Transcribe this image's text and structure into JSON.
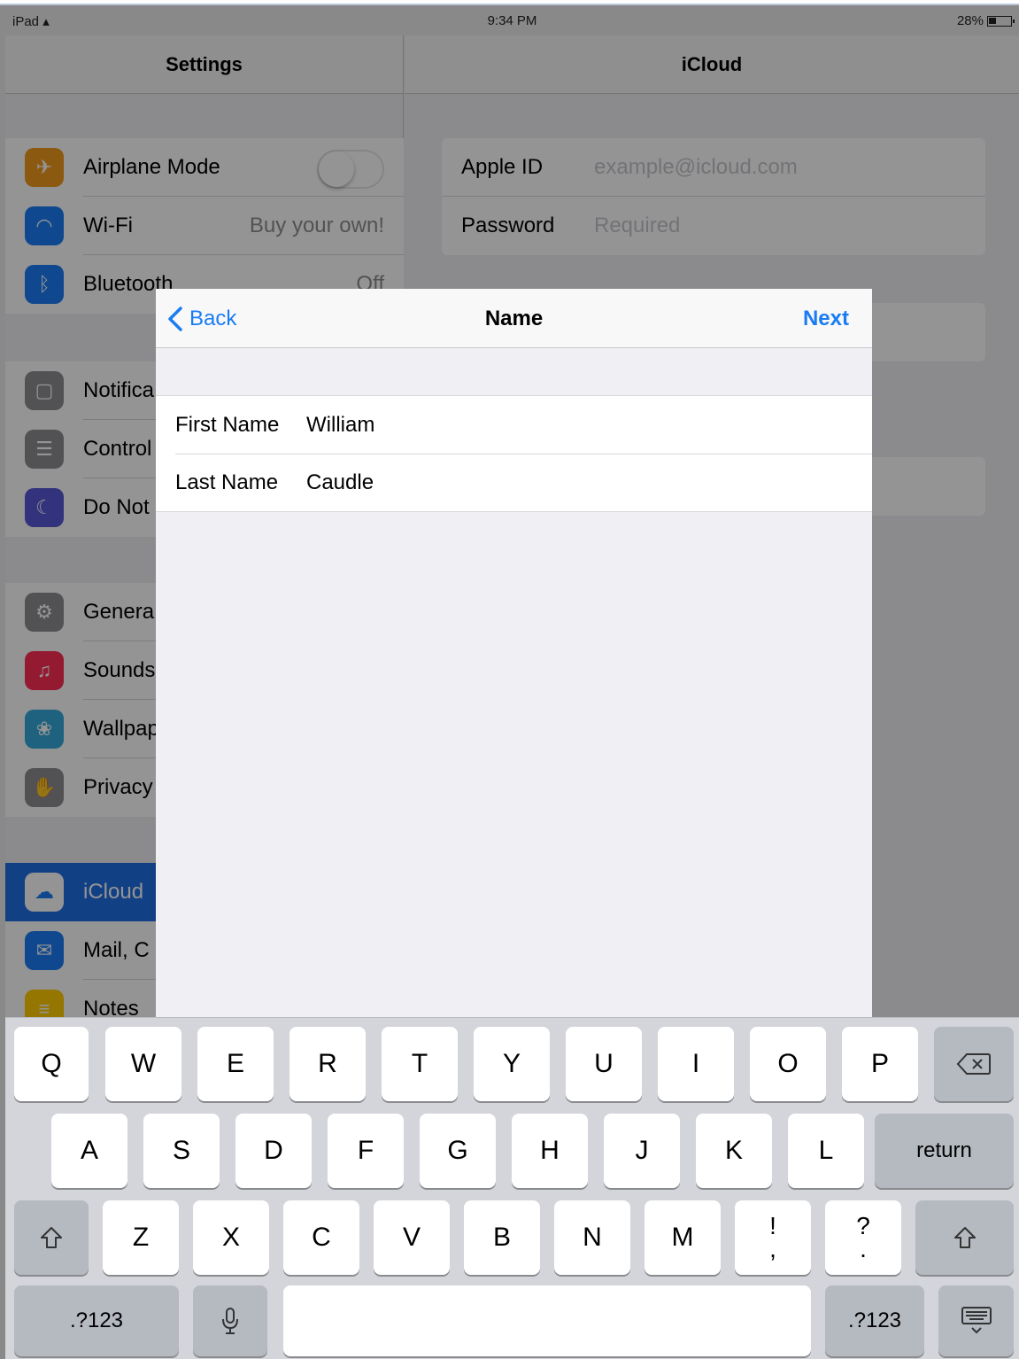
{
  "status_bar": {
    "device": "iPad",
    "time": "9:34 PM",
    "battery": "28%"
  },
  "master": {
    "title": "Settings",
    "group1": [
      {
        "label": "Airplane Mode",
        "icon": "airplane-icon",
        "color": "#f29a1d",
        "value": ""
      },
      {
        "label": "Wi-Fi",
        "icon": "wifi-icon",
        "color": "#1a7cf5",
        "value": "Buy your own!"
      },
      {
        "label": "Bluetooth",
        "icon": "bluetooth-icon",
        "color": "#1a7cf5",
        "value": "Off"
      }
    ],
    "group2": [
      {
        "label": "Notifica",
        "icon": "notifications-icon",
        "color": "#8e8e93"
      },
      {
        "label": "Control",
        "icon": "control-center-icon",
        "color": "#8e8e93"
      },
      {
        "label": "Do Not",
        "icon": "moon-icon",
        "color": "#5856d6"
      }
    ],
    "group3": [
      {
        "label": "Genera",
        "icon": "gear-icon",
        "color": "#8e8e93"
      },
      {
        "label": "Sounds",
        "icon": "speaker-icon",
        "color": "#ff2d55"
      },
      {
        "label": "Wallpap",
        "icon": "wallpaper-icon",
        "color": "#34aadc"
      },
      {
        "label": "Privacy",
        "icon": "hand-icon",
        "color": "#8e8e93"
      }
    ],
    "group4": [
      {
        "label": "iCloud",
        "icon": "cloud-icon",
        "color": "#ffffff"
      },
      {
        "label": "Mail, C",
        "icon": "mail-icon",
        "color": "#1a7cf5"
      },
      {
        "label": "Notes",
        "icon": "notes-icon",
        "color": "#ffcc00"
      }
    ]
  },
  "detail": {
    "title": "iCloud",
    "apple_id_label": "Apple ID",
    "apple_id_placeholder": "example@icloud.com",
    "password_label": "Password",
    "password_placeholder": "Required"
  },
  "modal": {
    "title": "Name",
    "back_label": "Back",
    "next_label": "Next",
    "first_name_label": "First Name",
    "first_name_value": "William",
    "last_name_label": "Last Name",
    "last_name_value": "Caudle"
  },
  "keyboard": {
    "row1": [
      "Q",
      "W",
      "E",
      "R",
      "T",
      "Y",
      "U",
      "I",
      "O",
      "P"
    ],
    "row2": [
      "A",
      "S",
      "D",
      "F",
      "G",
      "H",
      "J",
      "K",
      "L"
    ],
    "row3": [
      "Z",
      "X",
      "C",
      "V",
      "B",
      "N",
      "M"
    ],
    "return_label": "return",
    "numbers_label": ".?123",
    "excl_top": "!",
    "excl_bottom": ",",
    "quest_top": "?",
    "quest_bottom": "."
  }
}
